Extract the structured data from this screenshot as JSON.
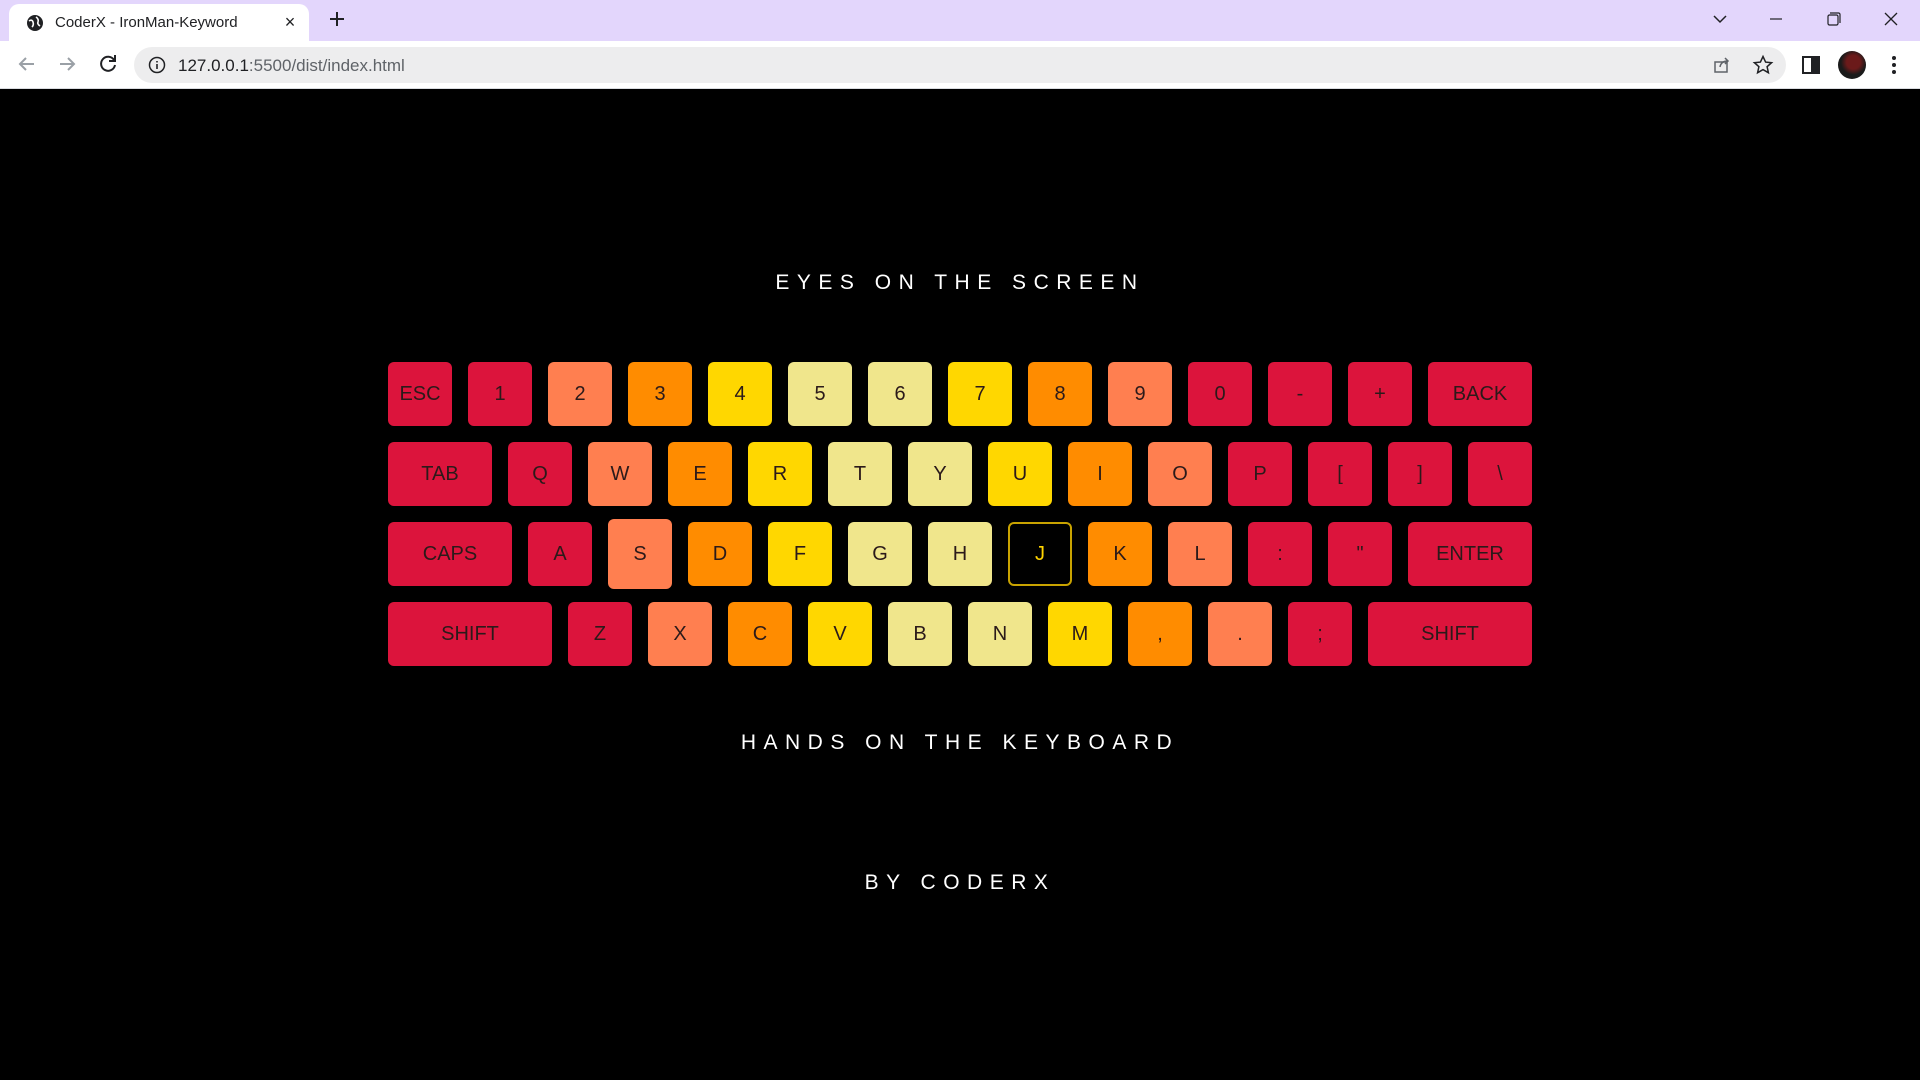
{
  "browser": {
    "tab_title": "CoderX - IronMan-Keyword",
    "tab_close": "×",
    "url_host": "127.0.0.1",
    "url_rest": ":5500/dist/index.html"
  },
  "page": {
    "top_caption": "EYES ON THE SCREEN",
    "bottom_caption": "HANDS ON THE KEYBOARD",
    "credit": "BY CODERX"
  },
  "colors": {
    "crimson": "#dc143c",
    "coral": "#ff7f50",
    "darkorange": "#ff8c00",
    "gold": "#ffd700",
    "khaki": "#f0e68c"
  },
  "keyboard": {
    "active_key": "J",
    "lifted_key": "S",
    "rows": [
      [
        {
          "label": "ESC",
          "color": "crimson"
        },
        {
          "label": "1",
          "color": "crimson"
        },
        {
          "label": "2",
          "color": "coral"
        },
        {
          "label": "3",
          "color": "darkorange"
        },
        {
          "label": "4",
          "color": "gold"
        },
        {
          "label": "5",
          "color": "khaki"
        },
        {
          "label": "6",
          "color": "khaki"
        },
        {
          "label": "7",
          "color": "gold"
        },
        {
          "label": "8",
          "color": "darkorange"
        },
        {
          "label": "9",
          "color": "coral"
        },
        {
          "label": "0",
          "color": "crimson"
        },
        {
          "label": "-",
          "color": "crimson"
        },
        {
          "label": "+",
          "color": "crimson"
        },
        {
          "label": "BACK",
          "color": "crimson"
        }
      ],
      [
        {
          "label": "TAB",
          "color": "crimson"
        },
        {
          "label": "Q",
          "color": "crimson"
        },
        {
          "label": "W",
          "color": "coral"
        },
        {
          "label": "E",
          "color": "darkorange"
        },
        {
          "label": "R",
          "color": "gold"
        },
        {
          "label": "T",
          "color": "khaki"
        },
        {
          "label": "Y",
          "color": "khaki"
        },
        {
          "label": "U",
          "color": "gold"
        },
        {
          "label": "I",
          "color": "darkorange"
        },
        {
          "label": "O",
          "color": "coral"
        },
        {
          "label": "P",
          "color": "crimson"
        },
        {
          "label": "[",
          "color": "crimson"
        },
        {
          "label": "]",
          "color": "crimson"
        },
        {
          "label": "\\",
          "color": "crimson"
        }
      ],
      [
        {
          "label": "CAPS",
          "color": "crimson"
        },
        {
          "label": "A",
          "color": "crimson"
        },
        {
          "label": "S",
          "color": "coral"
        },
        {
          "label": "D",
          "color": "darkorange"
        },
        {
          "label": "F",
          "color": "gold"
        },
        {
          "label": "G",
          "color": "khaki"
        },
        {
          "label": "H",
          "color": "khaki"
        },
        {
          "label": "J",
          "color": "gold"
        },
        {
          "label": "K",
          "color": "darkorange"
        },
        {
          "label": "L",
          "color": "coral"
        },
        {
          "label": ":",
          "color": "crimson"
        },
        {
          "label": "\"",
          "color": "crimson"
        },
        {
          "label": "ENTER",
          "color": "crimson"
        }
      ],
      [
        {
          "label": "SHIFT",
          "color": "crimson"
        },
        {
          "label": "Z",
          "color": "crimson"
        },
        {
          "label": "X",
          "color": "coral"
        },
        {
          "label": "C",
          "color": "darkorange"
        },
        {
          "label": "V",
          "color": "gold"
        },
        {
          "label": "B",
          "color": "khaki"
        },
        {
          "label": "N",
          "color": "khaki"
        },
        {
          "label": "M",
          "color": "gold"
        },
        {
          "label": ",",
          "color": "darkorange"
        },
        {
          "label": ".",
          "color": "coral"
        },
        {
          "label": ";",
          "color": "crimson"
        },
        {
          "label": "SHIFT",
          "color": "crimson"
        }
      ]
    ]
  }
}
